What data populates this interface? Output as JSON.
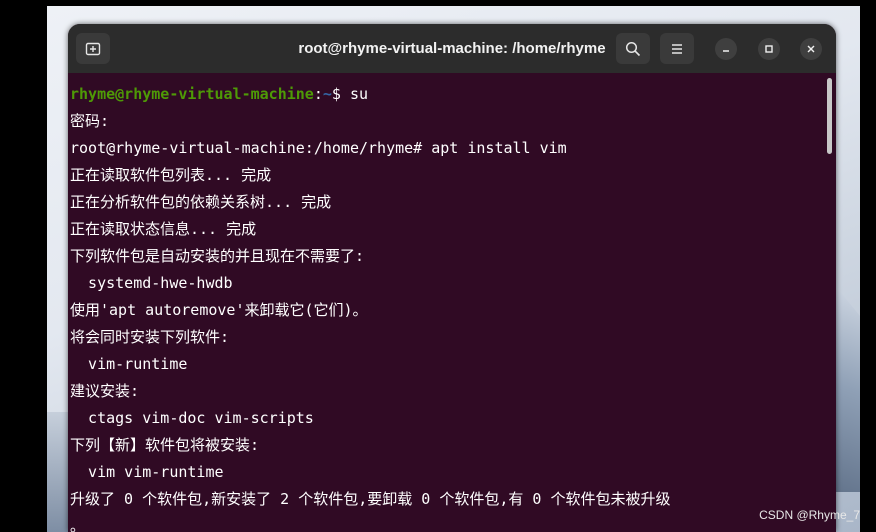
{
  "window": {
    "title": "root@rhyme-virtual-machine: /home/rhyme"
  },
  "icons": {
    "new_tab": "new-tab-icon",
    "search": "search-icon",
    "menu": "hamburger-menu-icon",
    "minimize": "minimize-icon",
    "maximize": "maximize-icon",
    "close": "close-icon"
  },
  "colors": {
    "terminal_bg": "#300a24",
    "user_host": "#4e9a06",
    "path": "#3465a4"
  },
  "prompt": {
    "user_host": "rhyme@rhyme-virtual-machine",
    "colon": ":",
    "path": "~",
    "symbol": "$ ",
    "command": "su"
  },
  "output": [
    "密码:",
    "root@rhyme-virtual-machine:/home/rhyme# apt install vim",
    "正在读取软件包列表... 完成",
    "正在分析软件包的依赖关系树... 完成",
    "正在读取状态信息... 完成",
    "下列软件包是自动安装的并且现在不需要了:",
    "  systemd-hwe-hwdb",
    "使用'apt autoremove'来卸载它(它们)。",
    "将会同时安装下列软件:",
    "  vim-runtime",
    "建议安装:",
    "  ctags vim-doc vim-scripts",
    "下列【新】软件包将被安装:",
    "  vim vim-runtime",
    "升级了 0 个软件包,新安装了 2 个软件包,要卸载 0 个软件包,有 0 个软件包未被升级",
    "。"
  ],
  "watermark": "CSDN @Rhyme_7"
}
